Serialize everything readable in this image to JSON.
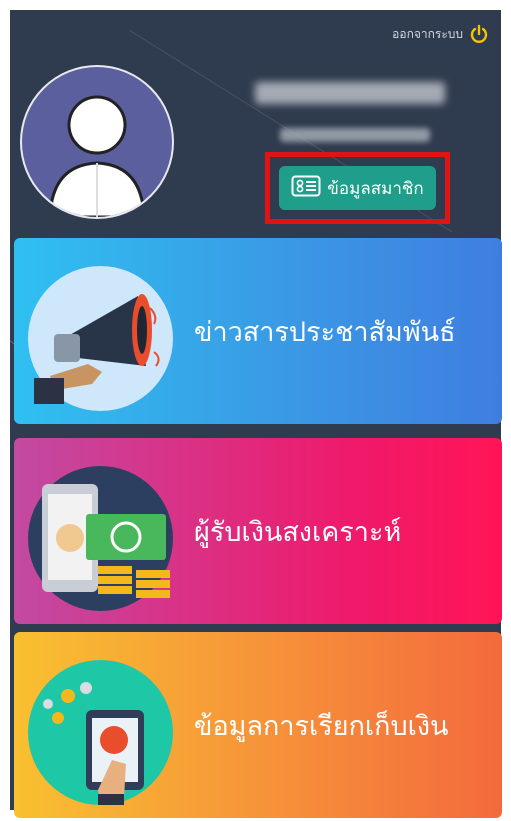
{
  "header": {
    "logout_label": "ออกจากระบบ",
    "logout_icon": "power-icon"
  },
  "profile": {
    "member_info_label": "ข้อมูลสมาชิก",
    "member_icon": "id-card-icon"
  },
  "menu": [
    {
      "label": "ข่าวสารประชาสัมพันธ์",
      "icon": "megaphone-icon"
    },
    {
      "label": "ผู้รับเงินสงเคราะห์",
      "icon": "money-phone-icon"
    },
    {
      "label": "ข้อมูลการเรียกเก็บเงิน",
      "icon": "pay-tablet-icon"
    }
  ],
  "colors": {
    "background": "#2f3b4e",
    "member_button": "#1f9f8b",
    "highlight_border": "#e01414",
    "news_card": "#3b96e4",
    "welfare_card": "#f0196a",
    "bill_card": "#f6903a",
    "power_icon": "#f5c400"
  }
}
